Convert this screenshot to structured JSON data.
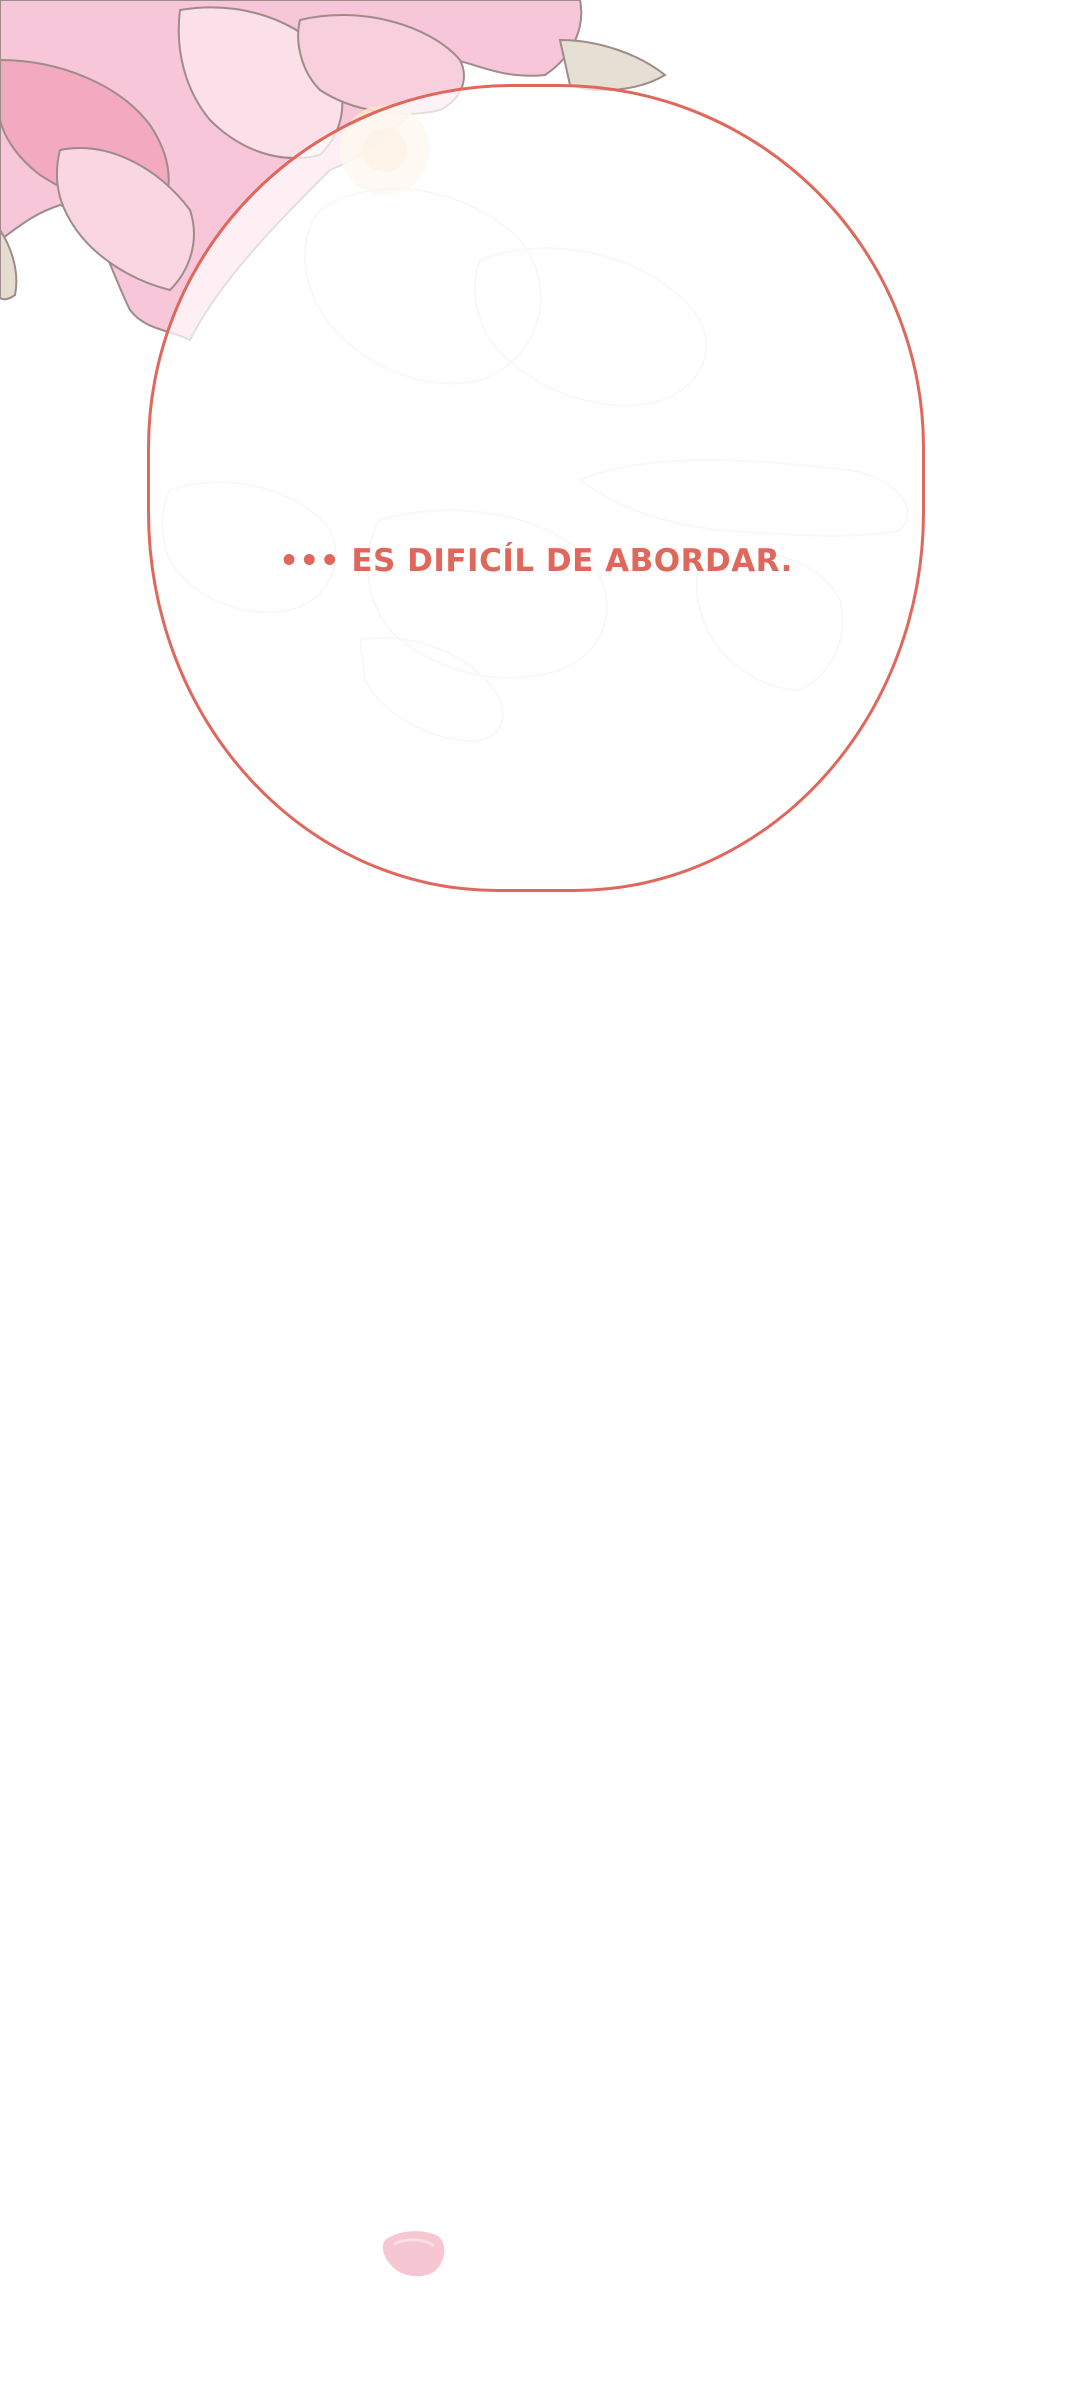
{
  "panel": {
    "speech_text": "••• ES DIFICÍL DE ABORDAR."
  },
  "colors": {
    "bubble_outline": "#e0675c",
    "text": "#e0675c",
    "petal_pink": "#f7c6d3",
    "background": "#ffffff"
  }
}
